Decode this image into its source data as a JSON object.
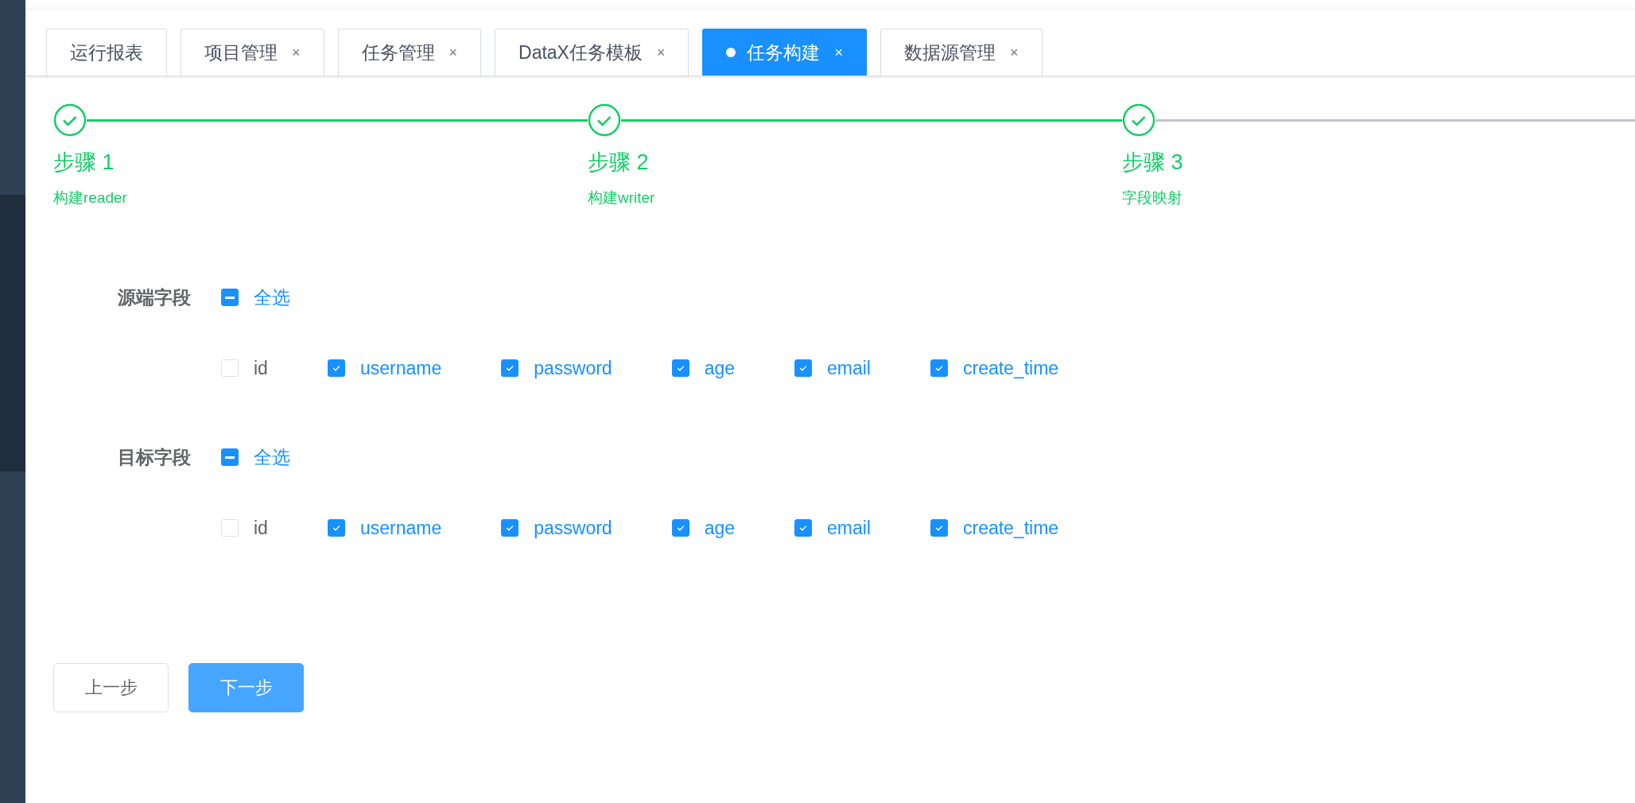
{
  "tabs": [
    {
      "label": "运行报表",
      "selected": false
    },
    {
      "label": "项目管理",
      "selected": false,
      "close": "×"
    },
    {
      "label": "任务管理",
      "selected": false,
      "close": "×"
    },
    {
      "label": "DataX任务模板",
      "selected": false,
      "close": "×"
    },
    {
      "label": "任务构建",
      "selected": true,
      "close": "×"
    },
    {
      "label": "数据源管理",
      "selected": false,
      "close": "×"
    }
  ],
  "steps": [
    {
      "title": "步骤 1",
      "description": "构建reader",
      "finished": true,
      "line_done": true
    },
    {
      "title": "步骤 2",
      "description": "构建writer",
      "finished": true,
      "line_done": true
    },
    {
      "title": "步骤 3",
      "description": "字段映射",
      "finished": true,
      "line_done": false
    }
  ],
  "field_groups": [
    {
      "label": "源端字段",
      "select_all": {
        "label": "全选",
        "indeterminate": true
      },
      "fields": [
        {
          "label": "id",
          "checked": false
        },
        {
          "label": "username",
          "checked": true
        },
        {
          "label": "password",
          "checked": true
        },
        {
          "label": "age",
          "checked": true
        },
        {
          "label": "email",
          "checked": true
        },
        {
          "label": "create_time",
          "checked": true
        }
      ]
    },
    {
      "label": "目标字段",
      "select_all": {
        "label": "全选",
        "indeterminate": true
      },
      "fields": [
        {
          "label": "id",
          "checked": false
        },
        {
          "label": "username",
          "checked": true
        },
        {
          "label": "password",
          "checked": true
        },
        {
          "label": "age",
          "checked": true
        },
        {
          "label": "email",
          "checked": true
        },
        {
          "label": "create_time",
          "checked": true
        }
      ]
    }
  ],
  "buttons": [
    {
      "label": "上一步",
      "kind": "default"
    },
    {
      "label": "下一步",
      "kind": "primary"
    }
  ]
}
